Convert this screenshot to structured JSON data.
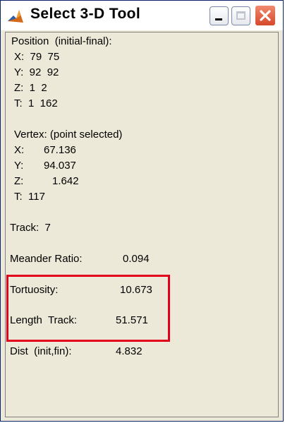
{
  "window": {
    "title": "Select 3-D Tool",
    "icon": "matlab-icon",
    "buttons": [
      "minimize-icon",
      "maximize-icon",
      "close-icon"
    ]
  },
  "position": {
    "header": "Position  (initial-final):",
    "x": "X:  79  75",
    "y": "Y:  92  92",
    "z": "Z:  1  2",
    "t": "T:  1  162"
  },
  "vertex": {
    "header": "Vertex: (point selected)",
    "x_label": "X:",
    "x_value": "67.136",
    "y_label": "Y:",
    "y_value": "94.037",
    "z_label": "Z:",
    "z_value": "1.642",
    "t": "T:  117"
  },
  "track": "Track:  7",
  "metrics": {
    "meander_label": "Meander Ratio:",
    "meander_value": "0.094",
    "tortuosity_label": "Tortuosity:",
    "tortuosity_value": "10.673",
    "length_label": "Length  Track:",
    "length_value": "51.571",
    "dist_label": "Dist  (init,fin):",
    "dist_value": "4.832"
  },
  "colors": {
    "highlight_border": "#e3001b",
    "panel_bg": "#ece9d8",
    "close_button": "#d6482a"
  }
}
